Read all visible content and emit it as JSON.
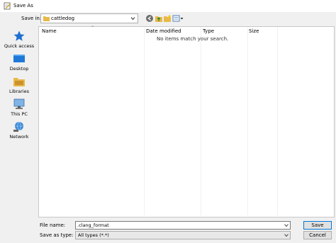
{
  "window": {
    "title": "Save As"
  },
  "location": {
    "label": "Save in:",
    "value": "cattledog"
  },
  "places": [
    {
      "label": "Quick access"
    },
    {
      "label": "Desktop"
    },
    {
      "label": "Libraries"
    },
    {
      "label": "This PC"
    },
    {
      "label": "Network"
    }
  ],
  "columns": [
    "Name",
    "Date modified",
    "Type",
    "Size"
  ],
  "empty_message": "No items match your search.",
  "file_name": {
    "label": "File name:",
    "value": ".clang_format"
  },
  "file_type": {
    "label": "Save as type:",
    "value": "All types (*.*)"
  },
  "buttons": {
    "save": "Save",
    "cancel": "Cancel"
  },
  "colors": {
    "accent": "#0078d7",
    "folder": "#e8b948"
  }
}
